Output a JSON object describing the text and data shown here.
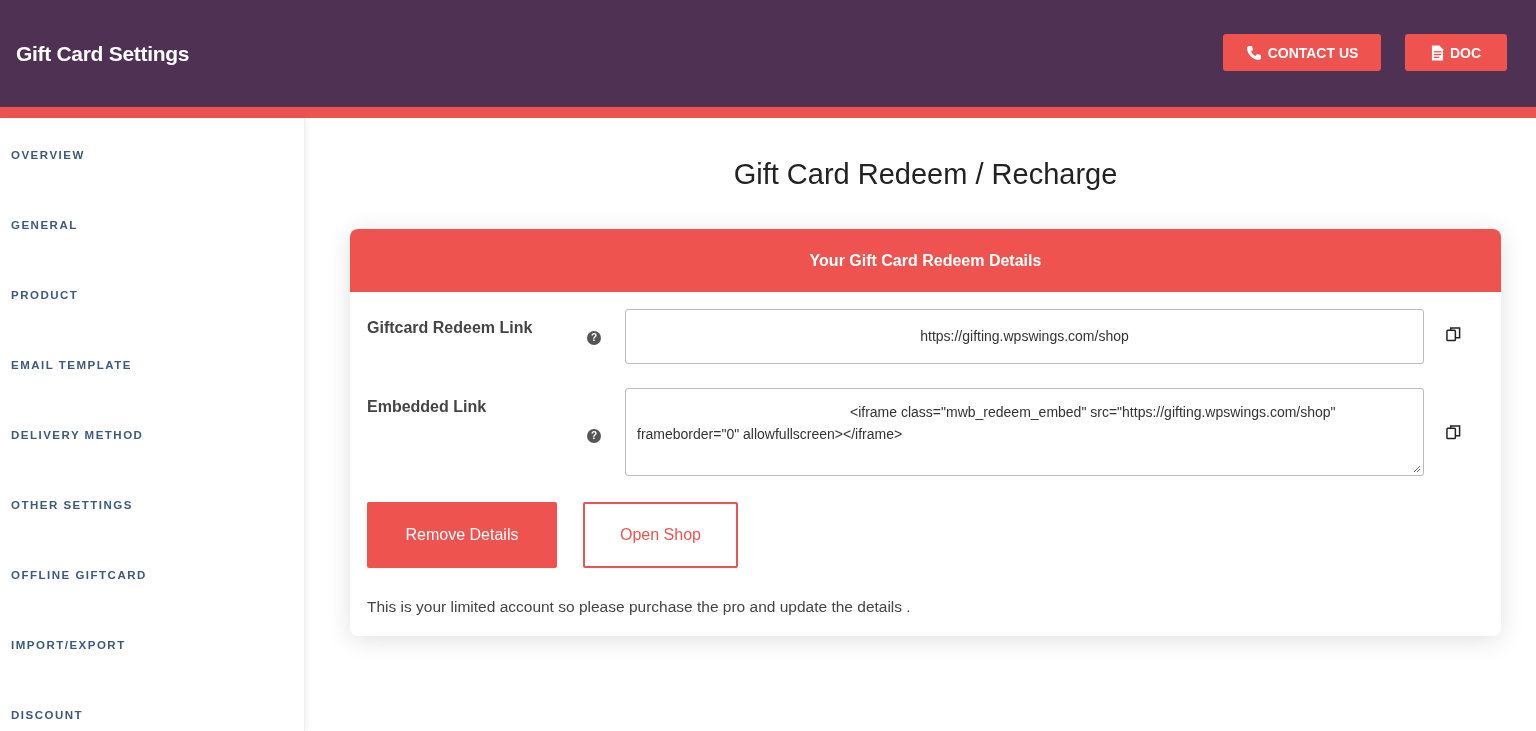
{
  "header": {
    "title": "Gift Card Settings",
    "buttons": [
      {
        "label": "CONTACT US",
        "kind": "phone"
      },
      {
        "label": "DOC",
        "kind": "doc"
      }
    ]
  },
  "sidebar": {
    "items": [
      {
        "label": "OVERVIEW"
      },
      {
        "label": "GENERAL"
      },
      {
        "label": "PRODUCT"
      },
      {
        "label": "EMAIL TEMPLATE"
      },
      {
        "label": "DELIVERY METHOD"
      },
      {
        "label": "OTHER SETTINGS"
      },
      {
        "label": "OFFLINE GIFTCARD"
      },
      {
        "label": "IMPORT/EXPORT"
      },
      {
        "label": "DISCOUNT"
      }
    ]
  },
  "page_title": "Gift Card Redeem / Recharge",
  "card": {
    "title": "Your Gift Card Redeem Details",
    "fields": [
      {
        "label": "Giftcard Redeem Link",
        "help": "?",
        "kind": "input",
        "value": "https://gifting.wpswings.com/shop"
      },
      {
        "label": "Embedded Link",
        "help": "?",
        "kind": "textarea",
        "value": "<iframe class=\"mwb_redeem_embed\" src=\"https://gifting.wpswings.com/shop\" frameborder=\"0\" allowfullscreen></iframe>"
      }
    ],
    "buttons": [
      {
        "label": "Remove Details",
        "kind": "primary"
      },
      {
        "label": "Open Shop",
        "kind": "outline"
      }
    ],
    "note": "This is your limited account so please purchase the pro and update the details ."
  }
}
